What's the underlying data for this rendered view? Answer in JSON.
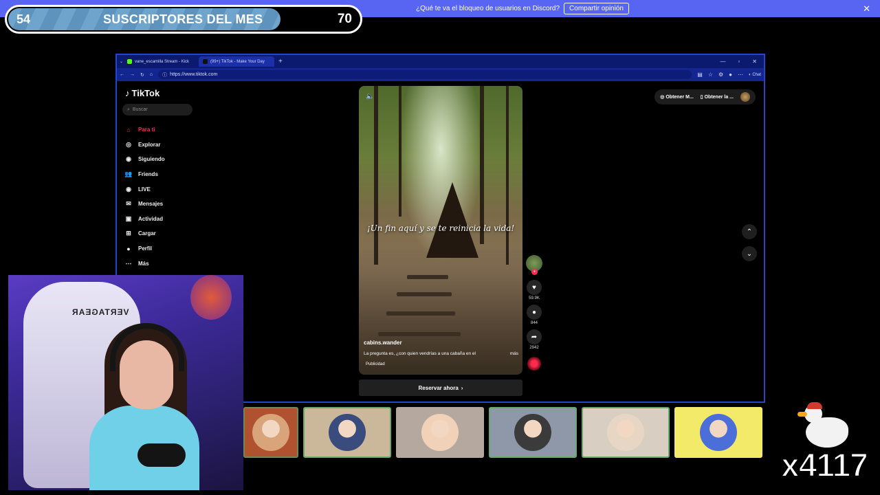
{
  "discord_banner": {
    "message": "¿Qué te va el bloqueo de usuarios en Discord?",
    "button": "Compartir opinión",
    "close": "✕"
  },
  "subgoal": {
    "current": "54",
    "title": "SUSCRIPTORES DEL MES",
    "goal": "70",
    "progress": 0.77
  },
  "browser": {
    "tabs": [
      {
        "label": "vane_escamilla Stream - Kick",
        "favicon_color": "#53fc18"
      },
      {
        "label": "(99+) TikTok - Make Your Day",
        "favicon_color": "#111111"
      }
    ],
    "url": "https://www.tiktok.com",
    "chat_label": "Chat",
    "window_controls": [
      "—",
      "▫",
      "✕"
    ]
  },
  "tiktok": {
    "logo": "TikTok",
    "search_placeholder": "Buscar",
    "nav": [
      {
        "label": "Para ti",
        "icon": "home-icon",
        "glyph": "⌂",
        "active": true
      },
      {
        "label": "Explorar",
        "icon": "compass-icon",
        "glyph": "◎"
      },
      {
        "label": "Siguiendo",
        "icon": "following-icon",
        "glyph": "◉"
      },
      {
        "label": "Friends",
        "icon": "friends-icon",
        "glyph": "👥"
      },
      {
        "label": "LIVE",
        "icon": "live-icon",
        "glyph": "◉"
      },
      {
        "label": "Mensajes",
        "icon": "messages-icon",
        "glyph": "✉"
      },
      {
        "label": "Actividad",
        "icon": "activity-icon",
        "glyph": "▣"
      },
      {
        "label": "Cargar",
        "icon": "upload-icon",
        "glyph": "⊞"
      },
      {
        "label": "Perfil",
        "icon": "profile-icon",
        "glyph": "●"
      },
      {
        "label": "Más",
        "icon": "more-icon",
        "glyph": "⋯"
      }
    ],
    "video": {
      "caption": "¡Un fin aquí y se te reinicia la vida!",
      "author": "cabins.wander",
      "description": "La pregunta es, ¿con quien vendrías a una cabaña en el",
      "more": "más",
      "ad_label": "Publicidad"
    },
    "reserve_button": "Reservar ahora",
    "actions": {
      "likes": "59.9K",
      "comments": "844",
      "shares": "2942"
    },
    "get_app": [
      "Obtener M...",
      "Obtener la ..."
    ]
  },
  "bottom_tiles": [
    {
      "name": "tile-avatar-1",
      "color": "#d9a47a"
    },
    {
      "name": "tile-avatar-2",
      "color": "#3a4b7d"
    },
    {
      "name": "tile-avatar-3",
      "color": "#f1d2b8"
    },
    {
      "name": "tile-avatar-4",
      "color": "#3b3b3b"
    },
    {
      "name": "tile-avatar-5",
      "color": "#e7d6c4"
    },
    {
      "name": "tile-avatar-6",
      "color": "#4c6ed9"
    }
  ],
  "duck_counter": "x4117",
  "colors": {
    "discord": "#5865f2",
    "tiktok_accent": "#fe2c55",
    "browser_border": "#2147c8"
  }
}
